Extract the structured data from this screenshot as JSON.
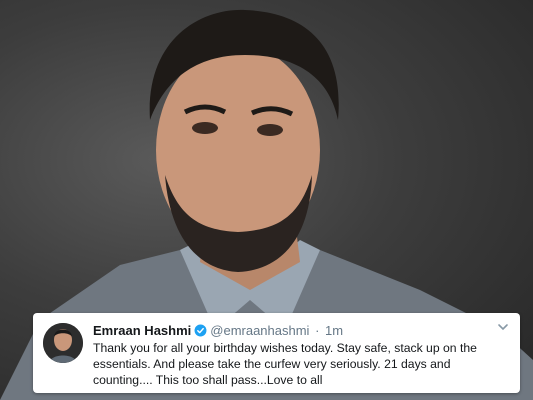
{
  "tweet": {
    "display_name": "Emraan Hashmi",
    "handle": "@emraanhashmi",
    "separator": "·",
    "timestamp": "1m",
    "text": "Thank you for all your birthday wishes today. Stay safe, stack up on the essentials. And please take the curfew very seriously. 21 days and counting.... This too shall pass...Love to all",
    "verified": true,
    "verified_color": "#1da1f2"
  },
  "icons": {
    "verified": "verified-badge-icon",
    "caret": "chevron-down-icon"
  }
}
